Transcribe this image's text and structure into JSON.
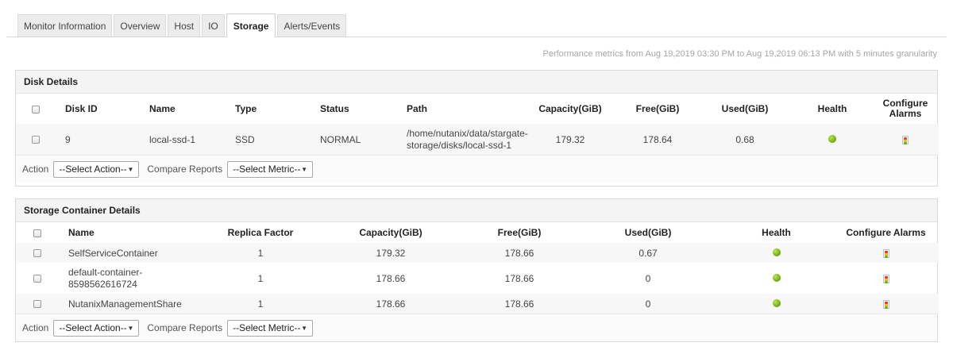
{
  "tabs": [
    {
      "label": "Monitor Information",
      "active": false
    },
    {
      "label": "Overview",
      "active": false
    },
    {
      "label": "Host",
      "active": false
    },
    {
      "label": "IO",
      "active": false
    },
    {
      "label": "Storage",
      "active": true
    },
    {
      "label": "Alerts/Events",
      "active": false
    }
  ],
  "perf_note": "Performance metrics from Aug 19,2019 03:30 PM to Aug 19,2019 06:13 PM with 5 minutes granularity",
  "disk": {
    "title": "Disk Details",
    "headers": {
      "disk_id": "Disk ID",
      "name": "Name",
      "type": "Type",
      "status": "Status",
      "path": "Path",
      "capacity": "Capacity(GiB)",
      "free": "Free(GiB)",
      "used": "Used(GiB)",
      "health": "Health",
      "configure_alarms": "Configure Alarms"
    },
    "rows": [
      {
        "disk_id": "9",
        "name": "local-ssd-1",
        "type": "SSD",
        "status": "NORMAL",
        "path": "/home/nutanix/data/stargate-storage/disks/local-ssd-1",
        "capacity": "179.32",
        "free": "178.64",
        "used": "0.68",
        "health": "green"
      }
    ],
    "action_label": "Action",
    "action_select": "--Select Action--",
    "compare_label": "Compare Reports",
    "compare_select": "--Select Metric--"
  },
  "container": {
    "title": "Storage Container Details",
    "headers": {
      "name": "Name",
      "replica_factor": "Replica Factor",
      "capacity": "Capacity(GiB)",
      "free": "Free(GiB)",
      "used": "Used(GiB)",
      "health": "Health",
      "configure_alarms": "Configure Alarms"
    },
    "rows": [
      {
        "name": "SelfServiceContainer",
        "replica_factor": "1",
        "capacity": "179.32",
        "free": "178.66",
        "used": "0.67",
        "health": "green"
      },
      {
        "name": "default-container-8598562616724",
        "replica_factor": "1",
        "capacity": "178.66",
        "free": "178.66",
        "used": "0",
        "health": "green"
      },
      {
        "name": "NutanixManagementShare",
        "replica_factor": "1",
        "capacity": "178.66",
        "free": "178.66",
        "used": "0",
        "health": "green"
      }
    ],
    "action_label": "Action",
    "action_select": "--Select Action--",
    "compare_label": "Compare Reports",
    "compare_select": "--Select Metric--"
  },
  "colors": {
    "health_ok": "#7cc01e",
    "alarm_red": "#e53a2c",
    "alarm_yellow": "#f3b11a",
    "alarm_green": "#66b321"
  },
  "icons": {
    "health": "health-status-icon",
    "alarm": "traffic-light-alarm-icon",
    "dropdown": "chevron-down-icon"
  }
}
